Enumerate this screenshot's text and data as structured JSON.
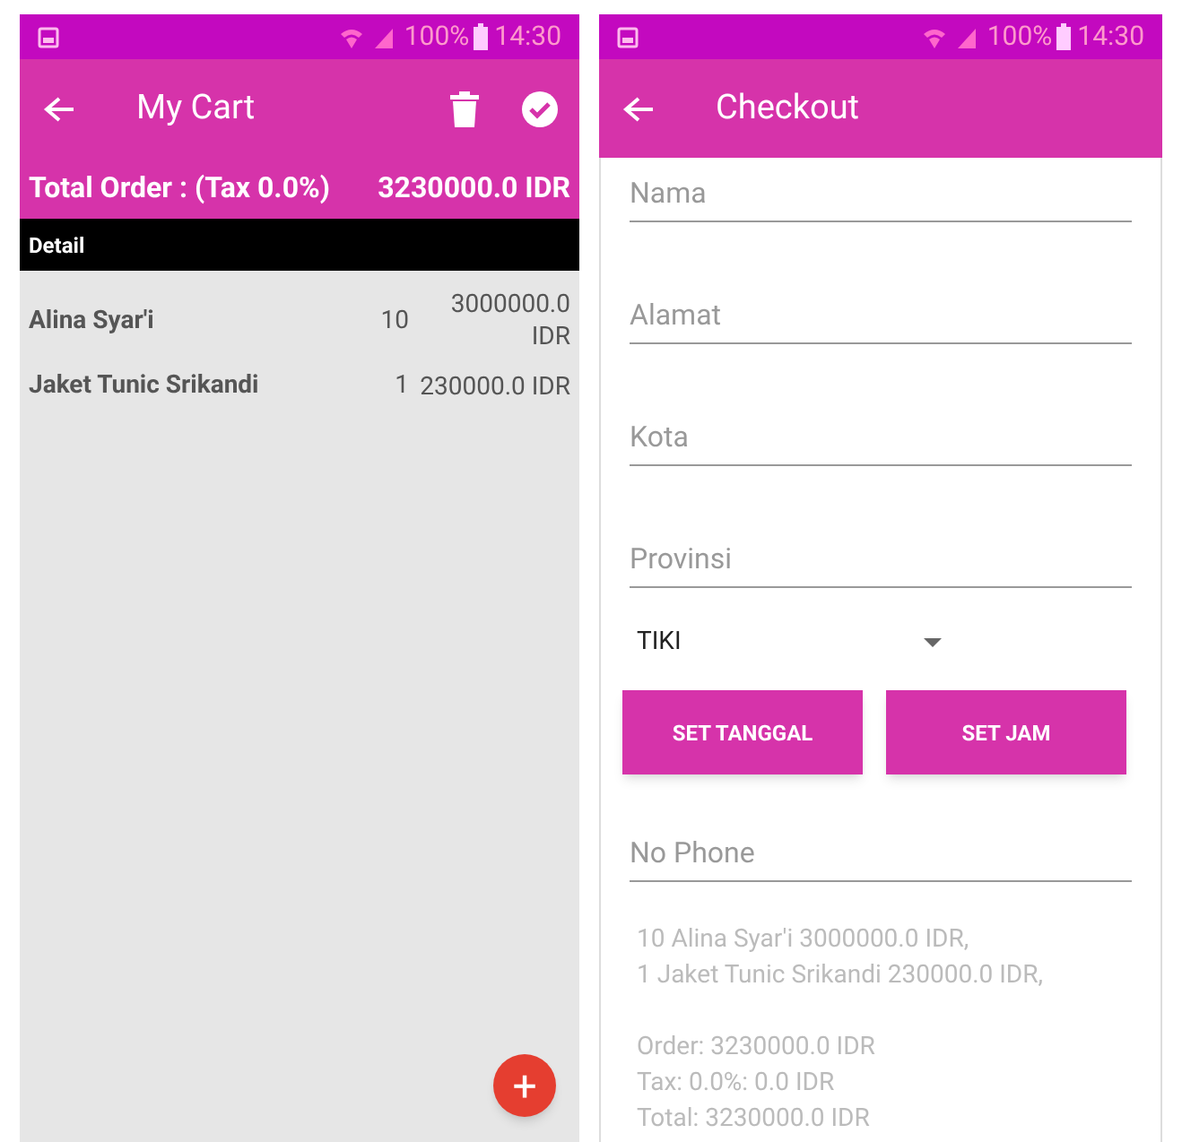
{
  "screens": [
    {
      "status_bar": {
        "battery": "100%",
        "time": "14:30"
      },
      "app_bar": {
        "title": "My Cart"
      },
      "total": {
        "label": "Total Order : (Tax 0.0%)",
        "value": "3230000.0 IDR"
      },
      "section_header": "Detail",
      "items": [
        {
          "name": "Alina Syar'i",
          "qty": "10",
          "price": "3000000.0 IDR"
        },
        {
          "name": "Jaket Tunic Srikandi",
          "qty": "1",
          "price": "230000.0 IDR"
        }
      ],
      "fab": "+"
    },
    {
      "status_bar": {
        "battery": "100%",
        "time": "14:30"
      },
      "app_bar": {
        "title": "Checkout"
      },
      "fields_top": [
        {
          "placeholder": "Nama"
        },
        {
          "placeholder": "Alamat"
        },
        {
          "placeholder": "Kota"
        },
        {
          "placeholder": "Provinsi"
        }
      ],
      "courier": {
        "value": "TIKI"
      },
      "buttons": [
        "SET TANGGAL",
        "SET JAM"
      ],
      "fields_bottom": [
        {
          "placeholder": "No Phone"
        }
      ],
      "summary": [
        [
          "10 Alina Syar'i 3000000.0 IDR,",
          "1 Jaket Tunic Srikandi 230000.0 IDR,"
        ],
        [
          "Order: 3230000.0 IDR",
          "Tax: 0.0%: 0.0 IDR",
          "Total: 3230000.0 IDR"
        ]
      ]
    }
  ]
}
